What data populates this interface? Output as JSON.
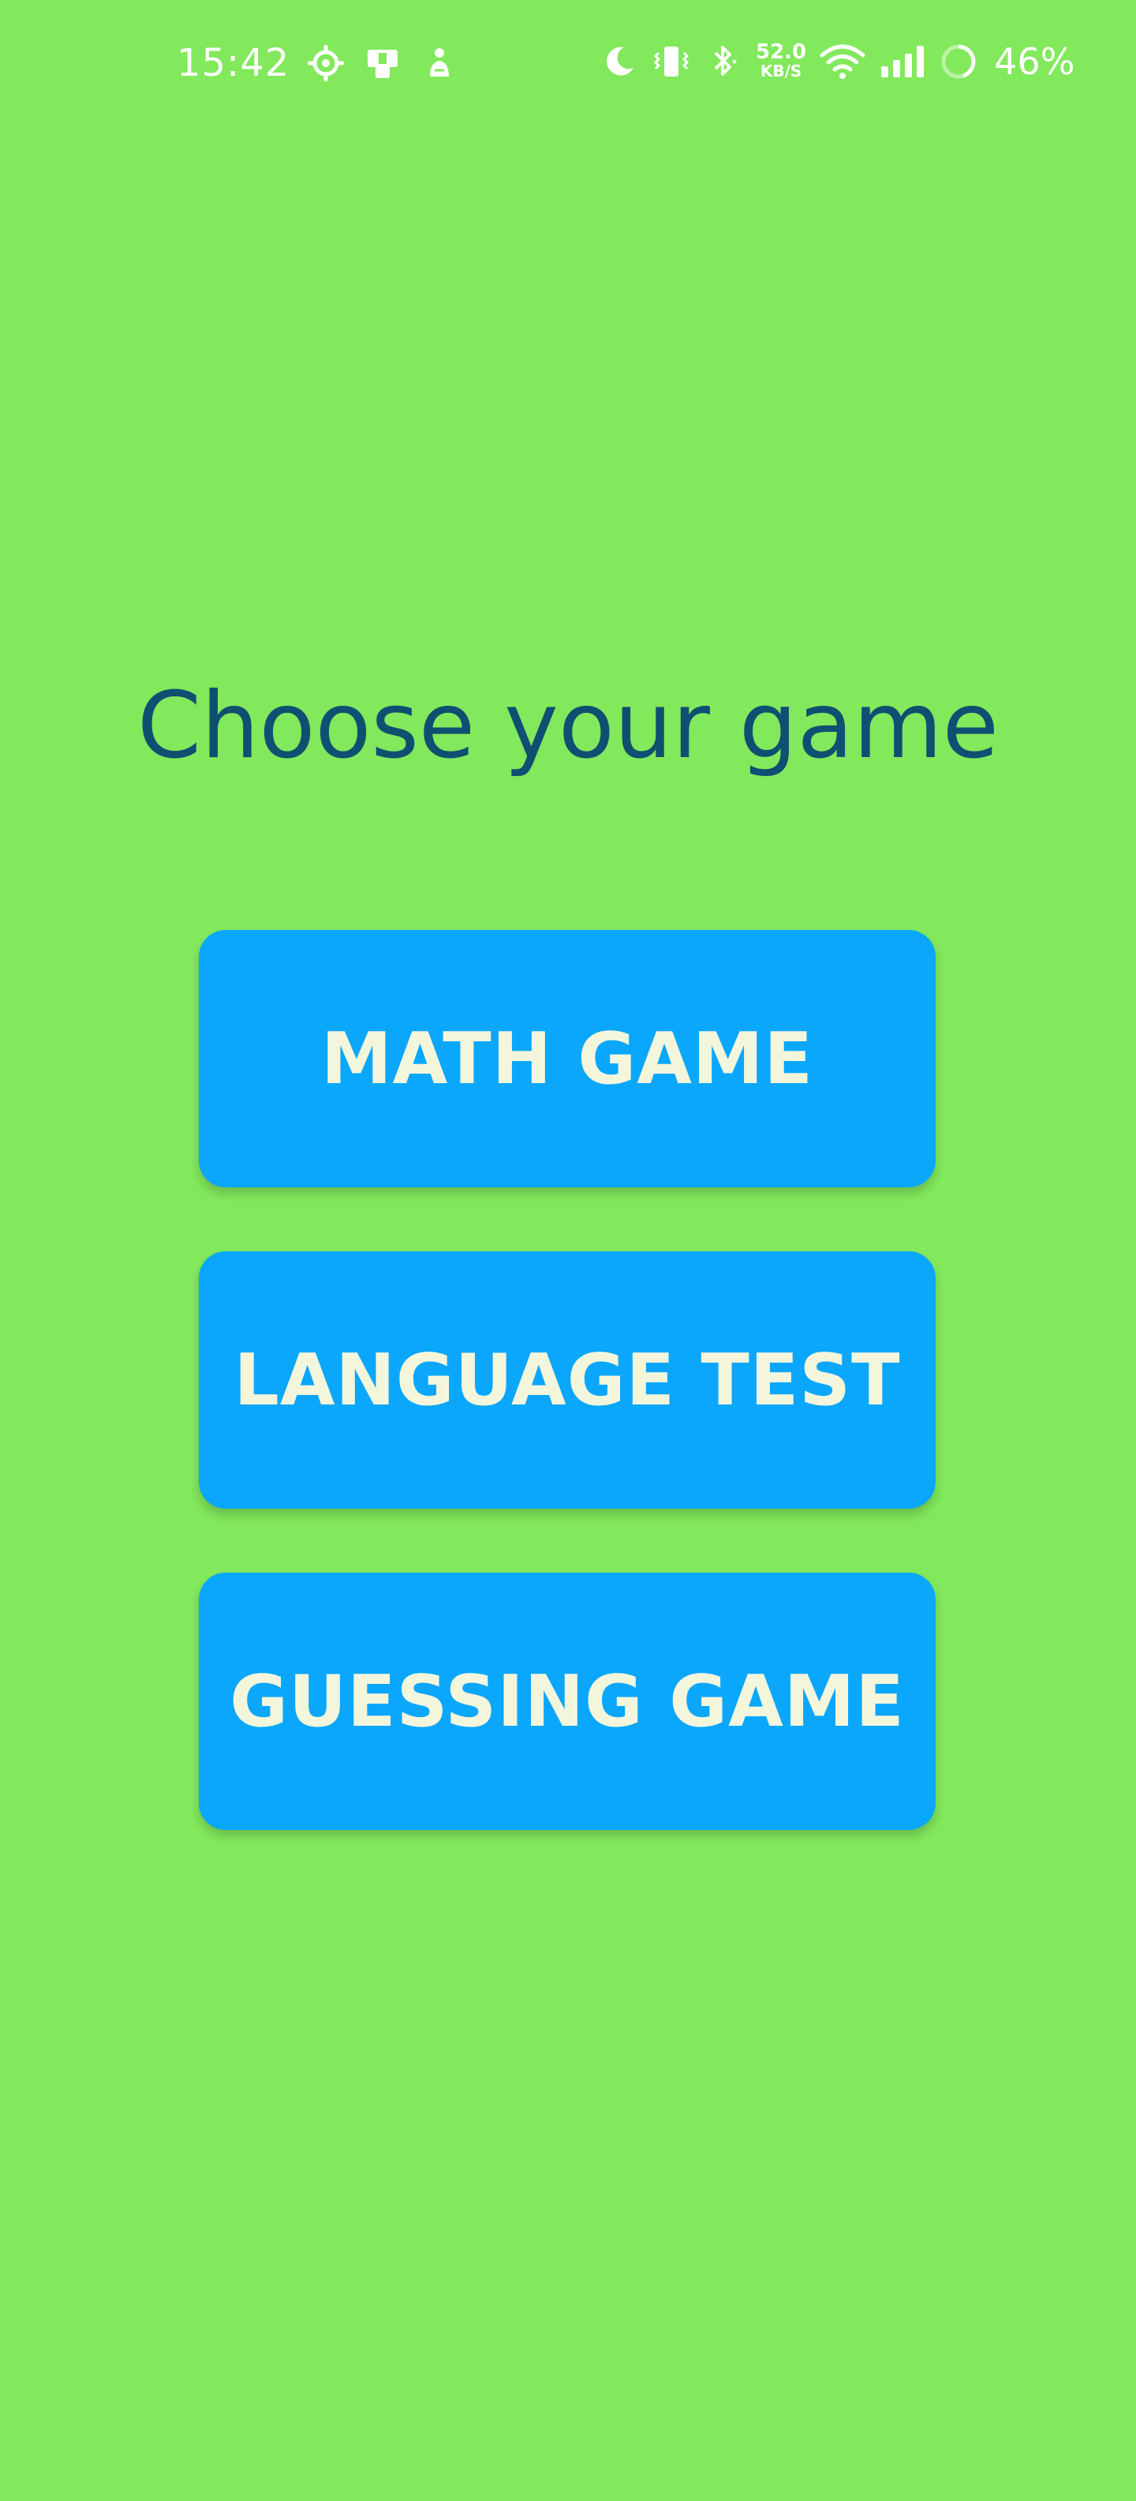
{
  "status_bar": {
    "time": "15:42",
    "net_speed_value": "52.0",
    "net_speed_unit": "KB/S",
    "battery_percent": "46%",
    "icons": [
      "settings-icon",
      "app-icon",
      "notification-icon",
      "moon-icon",
      "vibrate-icon",
      "bluetooth-icon",
      "wifi-icon",
      "signal-icon",
      "battery-icon"
    ]
  },
  "main": {
    "title": "Choose your game",
    "buttons": [
      {
        "label": "MATH GAME"
      },
      {
        "label": "LANGUAGE TEST"
      },
      {
        "label": "GUESSING GAME"
      }
    ]
  },
  "colors": {
    "background": "#82e85c",
    "title": "#0f4f71",
    "button_bg": "#0aa7fd",
    "button_text": "#f4f6dc"
  }
}
